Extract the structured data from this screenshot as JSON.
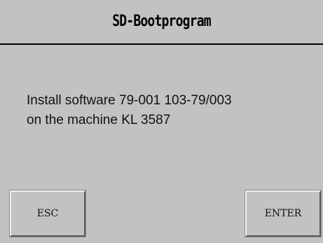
{
  "header": {
    "title": "SD-Bootprogram"
  },
  "message": {
    "line1": "Install software 79-001 103-79/003",
    "line2": "on the machine KL 3587"
  },
  "buttons": {
    "esc_label": "ESC",
    "enter_label": "ENTER"
  },
  "colors": {
    "background": "#c2c2c2",
    "text": "#000000"
  }
}
